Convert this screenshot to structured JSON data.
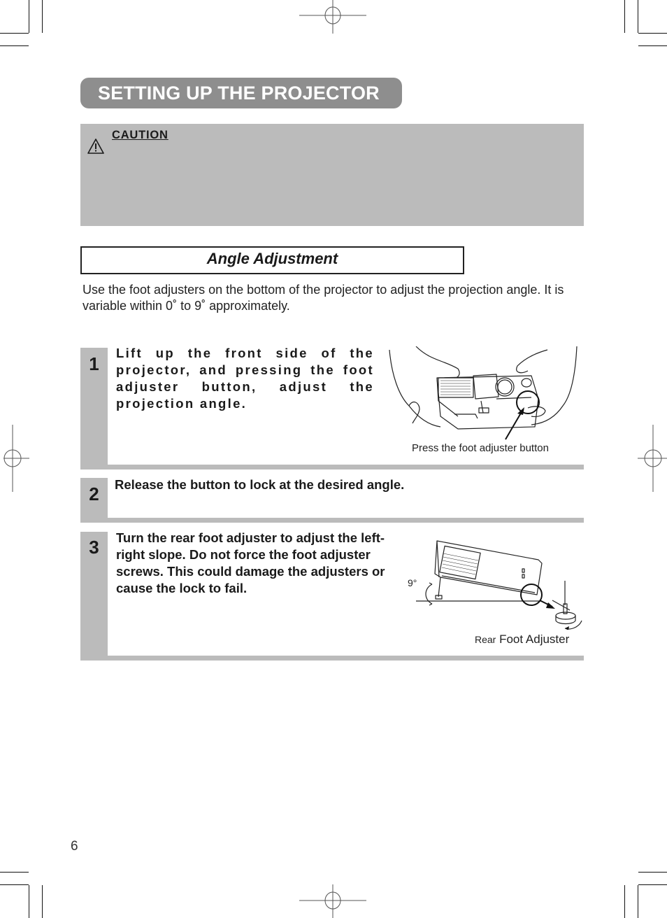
{
  "header": {
    "title": "SETTING UP THE PROJECTOR"
  },
  "caution": {
    "icon": "warning-triangle-icon",
    "heading": "CAUTION"
  },
  "section": {
    "title": "Angle Adjustment",
    "intro": "Use the foot adjusters on the bottom of the projector to adjust the projection angle. It is variable within 0˚ to 9˚ approximately."
  },
  "steps": [
    {
      "number": "1",
      "text": "Lift up the front side of the projector, and pressing the foot adjuster button, adjust the projection angle.",
      "figure_caption": "Press the foot adjuster button"
    },
    {
      "number": "2",
      "text": "Release the button to lock at the desired angle."
    },
    {
      "number": "3",
      "text": "Turn the rear foot adjuster to adjust the left-right slope. Do not force the foot adjuster screws. This could damage the adjusters or cause the lock to fail.",
      "figure_angle_label": "9°",
      "figure_caption_prefix": "Rear",
      "figure_caption": "Foot Adjuster"
    }
  ],
  "footer": {
    "page_number": "6"
  },
  "colors": {
    "title_pill": "#8e8e8e",
    "caution_bg": "#bbbbbb",
    "step_bar": "#bbbbbb"
  }
}
